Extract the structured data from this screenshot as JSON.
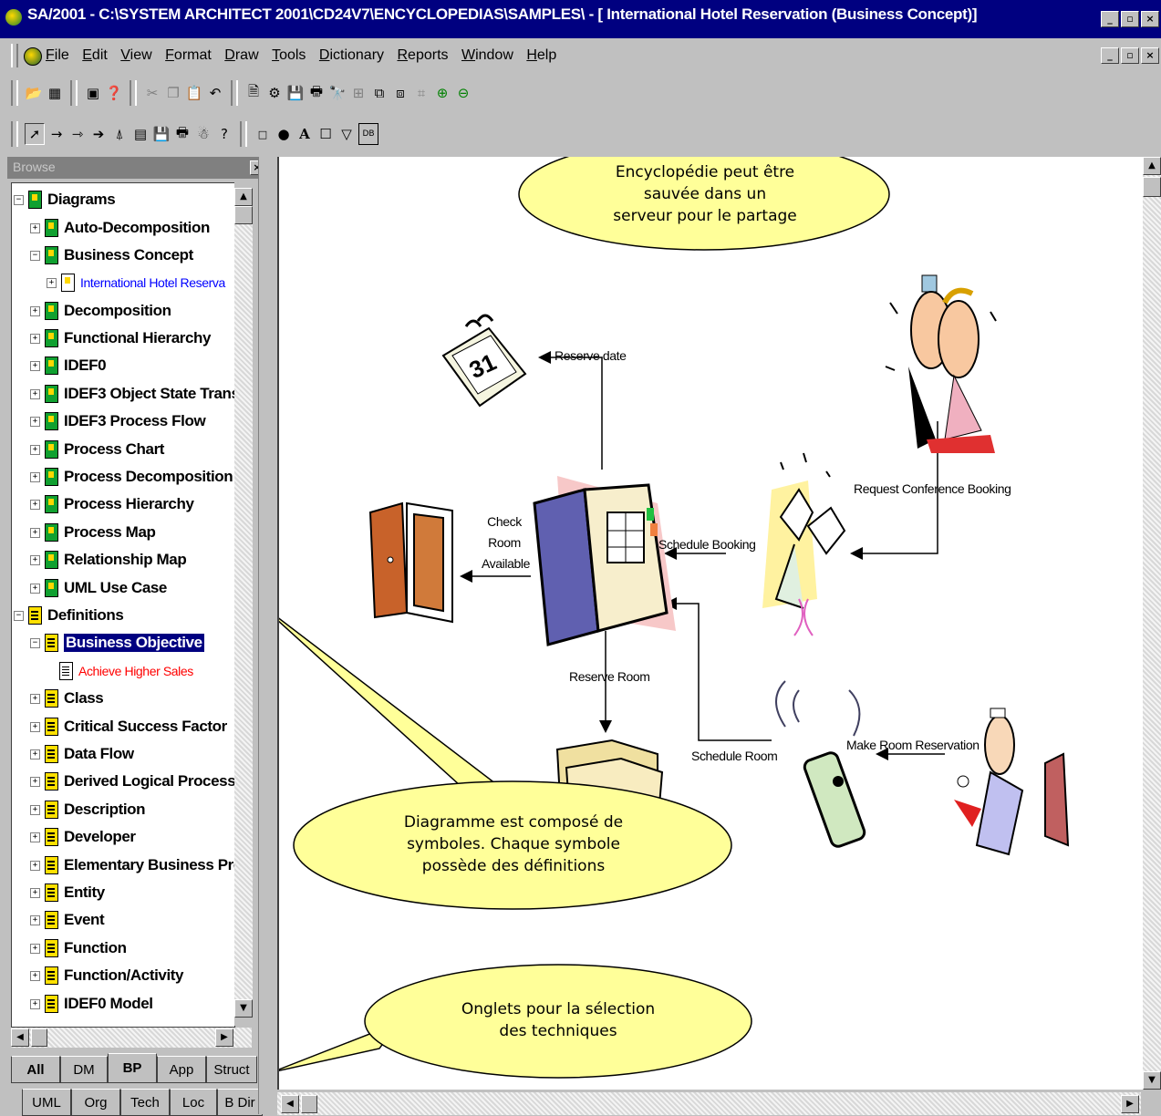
{
  "window": {
    "title": "SA/2001 - C:\\SYSTEM ARCHITECT 2001\\CD24V7\\ENCYCLOPEDIAS\\SAMPLES\\ - [ International Hotel Reservation (Business Concept)]",
    "minimize": "_",
    "restore": "▫",
    "close": "×"
  },
  "menu": [
    "File",
    "Edit",
    "View",
    "Format",
    "Draw",
    "Tools",
    "Dictionary",
    "Reports",
    "Window",
    "Help"
  ],
  "browse": {
    "title": "Browse",
    "close": "×",
    "tree": {
      "diagrams": "Diagrams",
      "auto_decomposition": "Auto-Decomposition",
      "business_concept": "Business Concept",
      "international_hotel": "International Hotel Reserva",
      "decomposition": "Decomposition",
      "functional_hierarchy": "Functional Hierarchy",
      "idef0": "IDEF0",
      "idef3_object": "IDEF3 Object State Trans",
      "idef3_process": "IDEF3 Process Flow",
      "process_chart": "Process Chart",
      "process_decomposition": "Process Decomposition",
      "process_hierarchy": "Process Hierarchy",
      "process_map": "Process Map",
      "relationship_map": "Relationship Map",
      "uml_use_case": "UML Use Case",
      "definitions": "Definitions",
      "business_objective": "Business Objective",
      "achieve_higher_sales": "Achieve Higher Sales",
      "class": "Class",
      "critical_success_factor": "Critical Success Factor",
      "data_flow": "Data Flow",
      "derived_logical_process": "Derived Logical Process",
      "description": "Description",
      "developer": "Developer",
      "elementary_business_proc": "Elementary Business Proc",
      "entity": "Entity",
      "event": "Event",
      "function": "Function",
      "function_activity": "Function/Activity",
      "idef0_model": "IDEF0 Model"
    }
  },
  "tabs": {
    "row1": [
      "All",
      "DM",
      "BP",
      "App",
      "Struct"
    ],
    "row2": [
      "UML",
      "Org",
      "Tech",
      "Loc",
      "B Dir"
    ],
    "active": "BP"
  },
  "diagram": {
    "reserve_date": "Reserve date",
    "check_room_available": [
      "Check",
      "Room",
      "Available"
    ],
    "schedule_booking": "Schedule Booking",
    "request_conference_booking": "Request Conference Booking",
    "reserve_room": "Reserve Room",
    "schedule_room": "Schedule Room",
    "make_room_reservation": "Make Room Reservation"
  },
  "callouts": {
    "encyclopedia": [
      "Encyclopédie peut être",
      "sauvée dans un",
      "serveur pour le partage"
    ],
    "diagram": [
      "Diagramme est composé de",
      "symboles. Chaque symbole",
      "possède des définitions"
    ],
    "tabs": [
      "Onglets pour la sélection",
      "des techniques"
    ]
  },
  "colors": {
    "titlebar": "#000080",
    "callout_fill": "#ffff99",
    "chrome": "#c0c0c0"
  }
}
